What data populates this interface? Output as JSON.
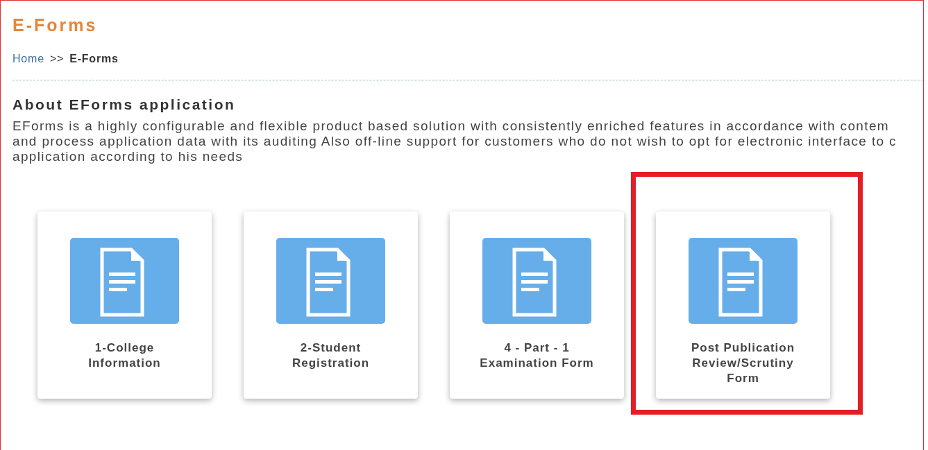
{
  "page_title": "E-Forms",
  "breadcrumb": {
    "links": [
      "Home"
    ],
    "separator": ">>",
    "current": "E-Forms"
  },
  "about": {
    "heading": "About EForms application",
    "lines": [
      "EForms is a highly configurable and flexible product based solution with consistently enriched features in accordance with contem",
      "and process application data with its auditing Also off-line support for customers who do not wish to opt for electronic interface to c",
      "application according to his needs"
    ]
  },
  "forms": [
    {
      "label": "1-College Information",
      "highlighted": false
    },
    {
      "label": "2-Student Registration",
      "highlighted": false
    },
    {
      "label": "4 - Part - 1 Examination Form",
      "highlighted": false
    },
    {
      "label": "Post Publication Review/Scrutiny Form",
      "highlighted": true
    }
  ]
}
